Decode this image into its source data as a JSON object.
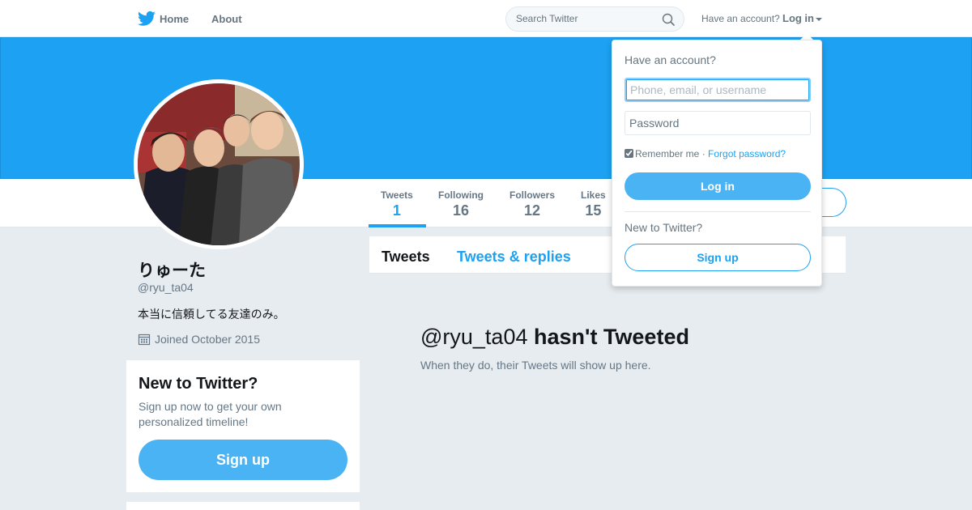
{
  "topnav": {
    "logo_icon": "bird-icon",
    "home_label": "Home",
    "about_label": "About",
    "search_placeholder": "Search Twitter",
    "have_account_text": "Have an account?",
    "login_label": "Log in"
  },
  "profile": {
    "name": "りゅーた",
    "handle": "@ryu_ta04",
    "bio": "本当に信頼してる友達のみ。",
    "joined": "Joined October 2015"
  },
  "stats": [
    {
      "label": "Tweets",
      "value": "1"
    },
    {
      "label": "Following",
      "value": "16"
    },
    {
      "label": "Followers",
      "value": "12"
    },
    {
      "label": "Likes",
      "value": "15"
    }
  ],
  "signup_module": {
    "title": "New to Twitter?",
    "description": "Sign up now to get your own personalized timeline!",
    "button": "Sign up"
  },
  "timeline": {
    "tabs": [
      "Tweets",
      "Tweets & replies"
    ],
    "empty_handle": "@ryu_ta04",
    "empty_title_rest": "hasn't Tweeted",
    "empty_subtitle": "When they do, their Tweets will show up here."
  },
  "login_dropdown": {
    "heading": "Have an account?",
    "username_placeholder": "Phone, email, or username",
    "password_placeholder": "Password",
    "remember_me": "Remember me",
    "separator": "·",
    "forgot_password": "Forgot password?",
    "login_button": "Log in",
    "new_to_twitter": "New to Twitter?",
    "signup_button": "Sign up"
  },
  "colors": {
    "brand": "#1da1f2",
    "button": "#4ab3f4",
    "background": "#e6ecf0"
  }
}
